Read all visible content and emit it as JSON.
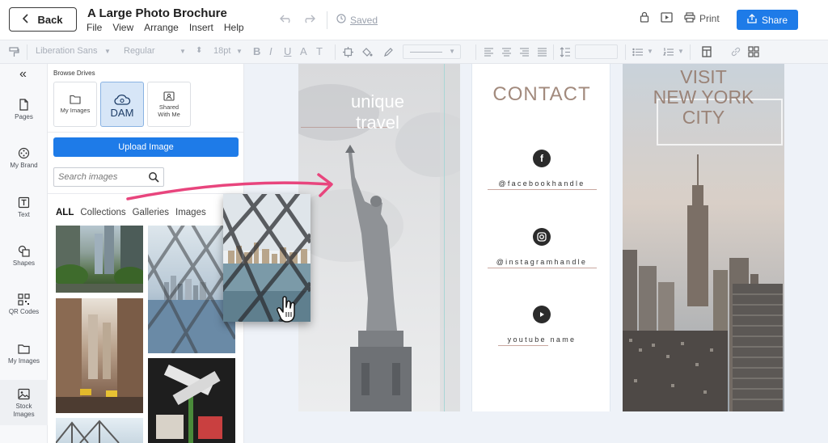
{
  "topbar": {
    "back_label": "Back",
    "doc_title": "A Large Photo Brochure",
    "menu": [
      "File",
      "View",
      "Arrange",
      "Insert",
      "Help"
    ],
    "saved_label": "Saved",
    "print_label": "Print",
    "share_label": "Share"
  },
  "toolbar": {
    "font_family": "Liberation Sans",
    "font_weight": "Regular",
    "font_size": "18pt",
    "bold": "B",
    "italic": "I",
    "underline": "U",
    "text_color": "A",
    "text_transform": "T"
  },
  "rail": {
    "collapse": "«",
    "items": [
      "Pages",
      "My Brand",
      "Text",
      "Shapes",
      "QR Codes",
      "My Images",
      "Stock Images"
    ]
  },
  "panel": {
    "browse_label": "Browse Drives",
    "drives": [
      "My Images",
      "DAM",
      "Shared With Me"
    ],
    "upload_label": "Upload Image",
    "search_placeholder": "Search images",
    "filters": [
      "ALL",
      "Collections",
      "Galleries",
      "Images"
    ]
  },
  "canvas": {
    "page1_text_line1": "unique",
    "page1_text_line2": "travel",
    "contact_title": "CONTACT",
    "handles": [
      "@facebookhandle",
      "@instagramhandle",
      "youtube name"
    ],
    "visit_line1": "VISIT",
    "visit_line2": "NEW YORK",
    "visit_line3": "CITY"
  },
  "colors": {
    "accent": "#1e7be8",
    "arrow": "#e8457d",
    "contact_text": "#a28a7d"
  }
}
